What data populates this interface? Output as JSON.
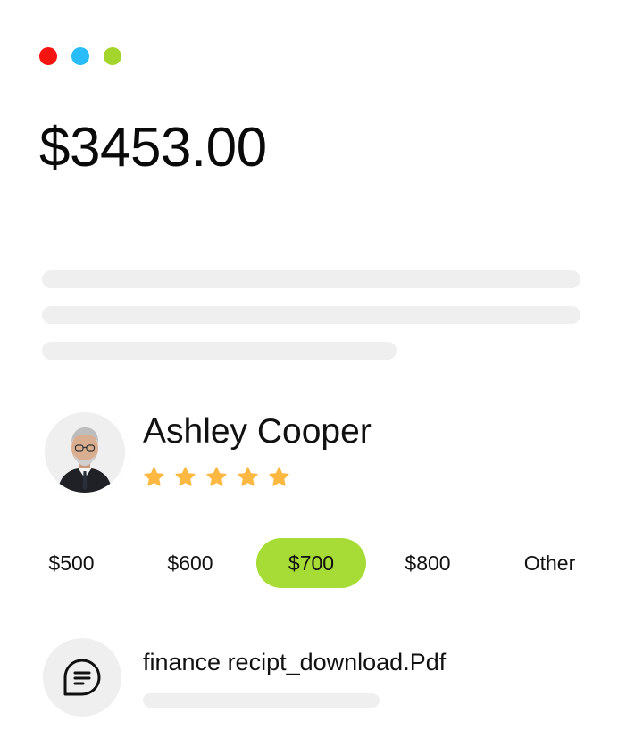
{
  "window_controls": {
    "close_color": "#f5140f",
    "minimize_color": "#28bdf9",
    "maximize_color": "#a3d52c"
  },
  "total_amount": "$3453.00",
  "user": {
    "name": "Ashley Cooper",
    "rating": 5,
    "rating_max": 5,
    "star_color": "#fdb842"
  },
  "amount_options": [
    {
      "label": "$500",
      "selected": false
    },
    {
      "label": "$600",
      "selected": false
    },
    {
      "label": "$700",
      "selected": true
    },
    {
      "label": "$800",
      "selected": false
    },
    {
      "label": "Other",
      "selected": false
    }
  ],
  "selected_color": "#a7dc36",
  "attachment": {
    "file_name": "finance recipt_download.Pdf",
    "icon": "document-lines-icon"
  }
}
